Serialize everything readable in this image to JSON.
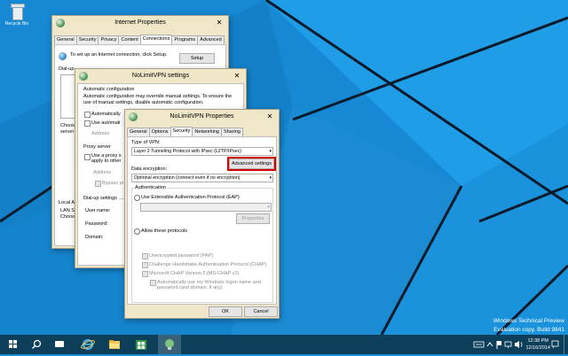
{
  "desktop": {
    "recycle_bin_label": "Recycle Bin",
    "watermark_line1": "Windows Technical Preview",
    "watermark_line2": "Evaluation copy. Build 9841"
  },
  "internet_properties": {
    "title": "Internet Properties",
    "close_glyph": "✕",
    "tabs": [
      "General",
      "Security",
      "Privacy",
      "Content",
      "Connections",
      "Programs",
      "Advanced"
    ],
    "active_tab": "Connections",
    "setup_text": "To set up an Internet connection, click Setup.",
    "setup_button": "Setup",
    "dialup_label": "Dial-up",
    "choose_text_1": "Choos",
    "choose_text_2": "server",
    "local_area_label": "Local A",
    "lan_text_1": "LAN S",
    "lan_text_2": "Choos"
  },
  "vpn_settings": {
    "title": "NoLimitVPN settings",
    "close_glyph": "✕",
    "auto_config_header": "Automatic configuration",
    "auto_config_text": "Automatic configuration may override manual settings. To ensure the use of manual settings, disable automatic configuration.",
    "auto_detect_label": "Automatically",
    "use_auto_label": "Use automati",
    "address_label": "Address",
    "proxy_header": "Proxy server",
    "use_proxy_label_1": "Use a proxy s",
    "use_proxy_label_2": "apply to other",
    "proxy_address_label": "Address",
    "bypass_label": "Bypass pr",
    "dialup_settings_header": "Dial-up settings",
    "username_label": "User name:",
    "password_label": "Password:",
    "domain_label": "Domain:"
  },
  "vpn_properties": {
    "title": "NoLimitVPN Properties",
    "close_glyph": "✕",
    "tabs": [
      "General",
      "Options",
      "Security",
      "Networking",
      "Sharing"
    ],
    "active_tab": "Security",
    "type_of_vpn_label": "Type of VPN:",
    "type_of_vpn_value": "Layer 2 Tunneling Protocol with IPsec (L2TP/IPsec)",
    "advanced_settings_button": "Advanced settings",
    "data_encryption_label": "Data encryption:",
    "data_encryption_value": "Optional encryption (connect even if no encryption)",
    "authentication_header": "Authentication",
    "eap_label": "Use Extensible Authentication Protocol (EAP)",
    "properties_button": "Properties",
    "allow_protocols_label": "Allow these protocols",
    "pap_label": "Unencrypted password (PAP)",
    "chap_label": "Challenge Handshake Authentication Protocol (CHAP)",
    "mschap_label": "Microsoft CHAP Version 2 (MS-CHAP v2)",
    "auto_logon_label_1": "Automatically use my Windows logon name and",
    "auto_logon_label_2": "password (and domain, if any)",
    "ok_button": "OK",
    "cancel_button": "Cancel"
  },
  "taskbar": {
    "items": [
      "start-icon",
      "search-icon",
      "task-view-icon",
      "internet-explorer-icon",
      "file-explorer-icon",
      "store-icon",
      "network-connections-icon"
    ],
    "time": "12:38 PM",
    "date": "12/16/2014"
  },
  "colors": {
    "desktop_bg": "#1a8fd9",
    "taskbar_bg": "#0e3f5a",
    "dialog_frame": "#f0e7c9",
    "highlight_box": "#d40000"
  }
}
